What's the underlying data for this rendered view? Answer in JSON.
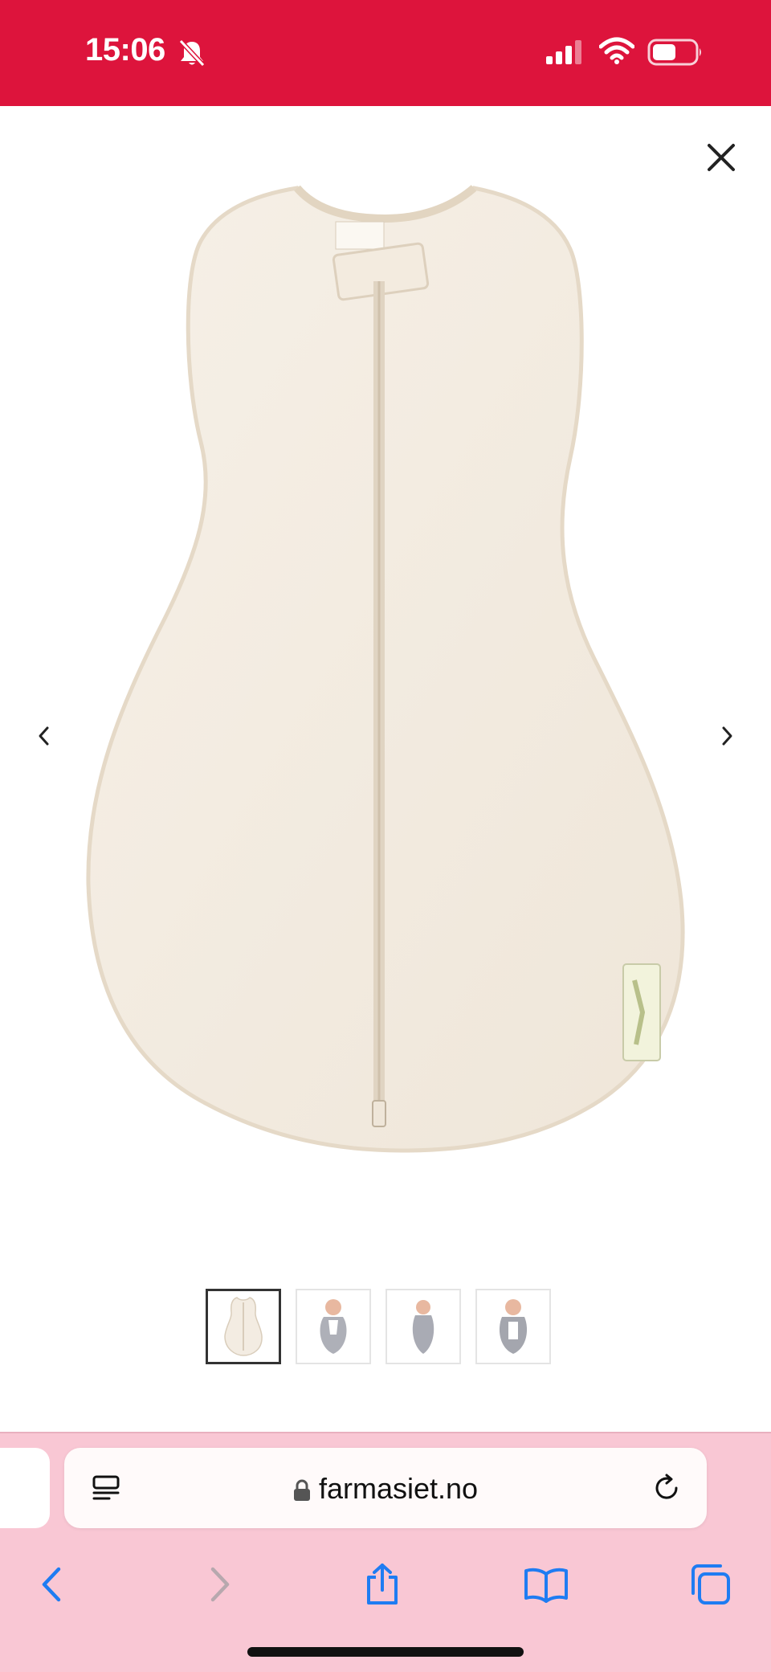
{
  "status_bar": {
    "time": "15:06",
    "icons": [
      "bell-slash-icon",
      "cellular-signal-icon",
      "wifi-icon",
      "battery-icon"
    ]
  },
  "viewer": {
    "close_icon": "close-icon",
    "prev_icon": "chevron-left-icon",
    "next_icon": "chevron-right-icon",
    "thumbnails": [
      {
        "name": "thumbnail-swaddle-front",
        "active": true
      },
      {
        "name": "thumbnail-baby-swaddle-1",
        "active": false
      },
      {
        "name": "thumbnail-baby-swaddle-2",
        "active": false
      },
      {
        "name": "thumbnail-baby-swaddle-3",
        "active": false
      }
    ]
  },
  "browser": {
    "url": "farmasiet.no",
    "toolbar_icons": [
      "back-icon",
      "forward-icon",
      "share-icon",
      "bookmarks-icon",
      "tabs-icon"
    ]
  },
  "colors": {
    "status_bar": "#dd143c",
    "browser_chrome": "#f9c7d4",
    "accent_blue": "#1f7cf2",
    "product_fabric": "#f3ece2"
  }
}
